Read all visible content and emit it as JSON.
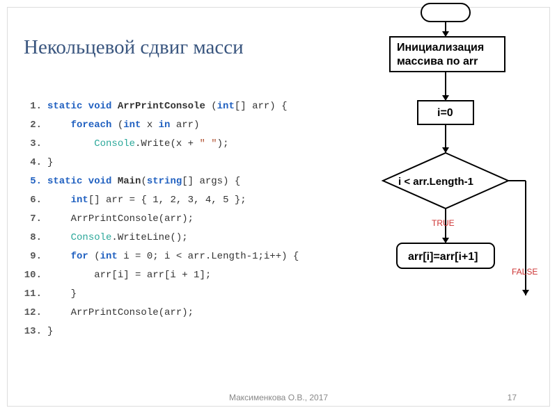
{
  "title": "Некольцевой сдвиг масси",
  "code": [
    {
      "n": "1.",
      "indent": 0,
      "tokens": [
        {
          "t": "static void ",
          "c": "kw"
        },
        {
          "t": "ArrPrintConsole ",
          "c": "mth"
        },
        {
          "t": "(",
          "c": ""
        },
        {
          "t": "int",
          "c": "kw"
        },
        {
          "t": "[] arr) {",
          "c": ""
        }
      ]
    },
    {
      "n": "2.",
      "indent": 1,
      "tokens": [
        {
          "t": "foreach ",
          "c": "kw"
        },
        {
          "t": "(",
          "c": ""
        },
        {
          "t": "int ",
          "c": "kw"
        },
        {
          "t": "x ",
          "c": ""
        },
        {
          "t": "in ",
          "c": "kw"
        },
        {
          "t": "arr)",
          "c": ""
        }
      ]
    },
    {
      "n": "3.",
      "indent": 2,
      "tokens": [
        {
          "t": "Console",
          "c": "tp"
        },
        {
          "t": ".Write(x + ",
          "c": ""
        },
        {
          "t": "\" \"",
          "c": "str"
        },
        {
          "t": ");",
          "c": ""
        }
      ]
    },
    {
      "n": "4.",
      "indent": 0,
      "tokens": [
        {
          "t": "}",
          "c": ""
        }
      ]
    },
    {
      "n": "5.",
      "indent": 0,
      "lnc": "ln5",
      "tokens": [
        {
          "t": "static void ",
          "c": "kw"
        },
        {
          "t": "Main",
          "c": "mth"
        },
        {
          "t": "(",
          "c": ""
        },
        {
          "t": "string",
          "c": "kw"
        },
        {
          "t": "[] args) {",
          "c": ""
        }
      ]
    },
    {
      "n": "6.",
      "indent": 1,
      "tokens": [
        {
          "t": "int",
          "c": "kw"
        },
        {
          "t": "[] arr = { ",
          "c": ""
        },
        {
          "t": "1, 2, 3, 4, 5",
          "c": "num"
        },
        {
          "t": " };",
          "c": ""
        }
      ]
    },
    {
      "n": "7.",
      "indent": 1,
      "tokens": [
        {
          "t": "ArrPrintConsole(arr);",
          "c": ""
        }
      ]
    },
    {
      "n": "8.",
      "indent": 1,
      "tokens": [
        {
          "t": "Console",
          "c": "tp"
        },
        {
          "t": ".WriteLine();",
          "c": ""
        }
      ]
    },
    {
      "n": "9.",
      "indent": 1,
      "tokens": [
        {
          "t": "for ",
          "c": "kw"
        },
        {
          "t": "(",
          "c": ""
        },
        {
          "t": "int ",
          "c": "kw"
        },
        {
          "t": "i = ",
          "c": ""
        },
        {
          "t": "0",
          "c": "num"
        },
        {
          "t": "; i < arr.Length-",
          "c": ""
        },
        {
          "t": "1",
          "c": "num"
        },
        {
          "t": ";i++) {",
          "c": ""
        }
      ]
    },
    {
      "n": "10.",
      "indent": 2,
      "tokens": [
        {
          "t": "arr[i] = arr[i + ",
          "c": ""
        },
        {
          "t": "1",
          "c": "num"
        },
        {
          "t": "];",
          "c": ""
        }
      ]
    },
    {
      "n": "11.",
      "indent": 1,
      "tokens": [
        {
          "t": "}",
          "c": ""
        }
      ]
    },
    {
      "n": "12.",
      "indent": 1,
      "tokens": [
        {
          "t": "ArrPrintConsole(arr);",
          "c": ""
        }
      ]
    },
    {
      "n": "13.",
      "indent": 0,
      "tokens": [
        {
          "t": "}",
          "c": ""
        }
      ]
    }
  ],
  "flow": {
    "init1": "Инициализация",
    "init2": "массива по arr",
    "ieq": "i=0",
    "cond": "i < arr.Length-1",
    "assign": "arr[i]=arr[i+1]",
    "true": "TRUE",
    "false": "FALSE"
  },
  "footer": {
    "attr": "Максименкова О.В., 2017",
    "page": "17"
  }
}
